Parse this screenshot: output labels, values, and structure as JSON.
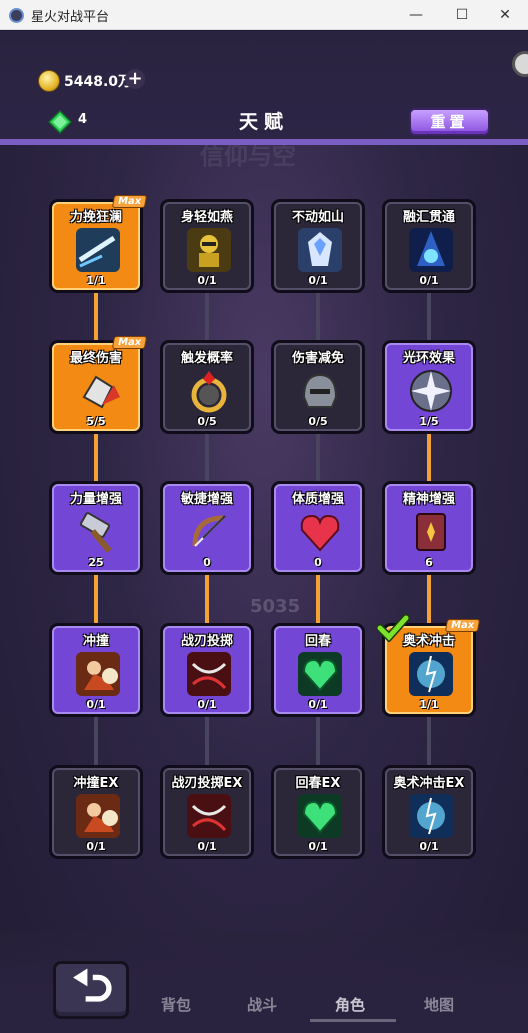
{
  "window": {
    "title": "星火对战平台",
    "min": "—",
    "max": "☐",
    "close": "✕"
  },
  "resources": {
    "coins": "5448.0万",
    "gems": "4"
  },
  "header": {
    "title": "天赋",
    "reset_label": "重置"
  },
  "background_text": {
    "ghost1": "信仰与空",
    "ghost2": "5035"
  },
  "talents": [
    [
      {
        "name": "力挽狂澜",
        "count": "1/1",
        "state": "orange",
        "max": "Max",
        "icon": "sword-dash-icon"
      },
      {
        "name": "身轻如燕",
        "count": "0/1",
        "state": "dark",
        "icon": "ninja-icon"
      },
      {
        "name": "不动如山",
        "count": "0/1",
        "state": "dark",
        "icon": "armored-knight-icon"
      },
      {
        "name": "融汇贯通",
        "count": "0/1",
        "state": "dark",
        "icon": "hooded-mage-icon"
      }
    ],
    [
      {
        "name": "最终伤害",
        "count": "5/5",
        "state": "orange",
        "max": "Max",
        "icon": "fist-icon"
      },
      {
        "name": "触发概率",
        "count": "0/5",
        "state": "dark",
        "icon": "ring-icon"
      },
      {
        "name": "伤害减免",
        "count": "0/5",
        "state": "dark",
        "icon": "helmet-icon"
      },
      {
        "name": "光环效果",
        "count": "1/5",
        "state": "purple",
        "icon": "star-compass-icon"
      }
    ],
    [
      {
        "name": "力量增强",
        "count": "25",
        "state": "purple",
        "icon": "hammer-icon"
      },
      {
        "name": "敏捷增强",
        "count": "0",
        "state": "purple",
        "icon": "bow-icon"
      },
      {
        "name": "体质增强",
        "count": "0",
        "state": "purple",
        "icon": "heart-icon"
      },
      {
        "name": "精神增强",
        "count": "6",
        "state": "purple",
        "icon": "spellbook-icon"
      }
    ],
    [
      {
        "name": "冲撞",
        "count": "0/1",
        "state": "purple",
        "icon": "charge-warrior-icon"
      },
      {
        "name": "战刃投掷",
        "count": "0/1",
        "state": "purple",
        "icon": "blade-throw-icon"
      },
      {
        "name": "回春",
        "count": "0/1",
        "state": "purple",
        "icon": "green-heart-gem-icon"
      },
      {
        "name": "奥术冲击",
        "count": "1/1",
        "state": "orange",
        "max": "Max",
        "check": true,
        "icon": "arcane-blast-icon"
      }
    ],
    [
      {
        "name": "冲撞EX",
        "count": "0/1",
        "state": "dark",
        "icon": "charge-warrior-icon"
      },
      {
        "name": "战刃投掷EX",
        "count": "0/1",
        "state": "dark",
        "icon": "blade-throw-icon"
      },
      {
        "name": "回春EX",
        "count": "0/1",
        "state": "dark",
        "icon": "green-heart-gem-icon"
      },
      {
        "name": "奥术冲击EX",
        "count": "0/1",
        "state": "dark",
        "icon": "arcane-blast-icon"
      }
    ]
  ],
  "nav": {
    "bag": "背包",
    "battle": "战斗",
    "hero": "角色",
    "map": "地图"
  },
  "colors": {
    "orange": "#f28a14",
    "purple": "#7446d6",
    "dark": "#2b2738",
    "accent": "#7b5fc4"
  }
}
